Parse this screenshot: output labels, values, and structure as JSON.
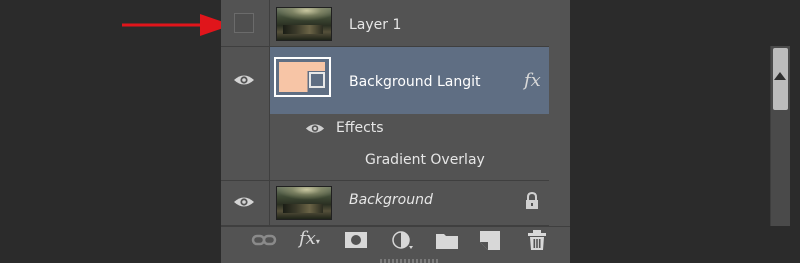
{
  "layers": [
    {
      "name": "Layer 1",
      "visible": false,
      "selected": false,
      "italic": false
    },
    {
      "name": "Background Langit",
      "visible": true,
      "selected": true,
      "italic": false,
      "fx_label": "fx"
    },
    {
      "name": "Background",
      "visible": true,
      "selected": false,
      "italic": true,
      "locked": true
    }
  ],
  "effects": {
    "label": "Effects",
    "items": [
      "Gradient Overlay"
    ]
  },
  "annotation": {
    "color": "#e0151b",
    "points_to": "layer-1-visibility-toggle"
  },
  "colors": {
    "panel_bg": "#535353",
    "selected_bg": "#5f6e83",
    "shape_fill": "#f7c5a6",
    "scroll_thumb": "#bcbcbc"
  },
  "toolbar": {
    "buttons": [
      {
        "icon": "link-icon"
      },
      {
        "icon": "fx-icon",
        "label": "fx"
      },
      {
        "icon": "layer-mask-icon"
      },
      {
        "icon": "adjustment-layer-icon"
      },
      {
        "icon": "folder-icon"
      },
      {
        "icon": "new-layer-icon"
      },
      {
        "icon": "trash-icon"
      }
    ]
  }
}
